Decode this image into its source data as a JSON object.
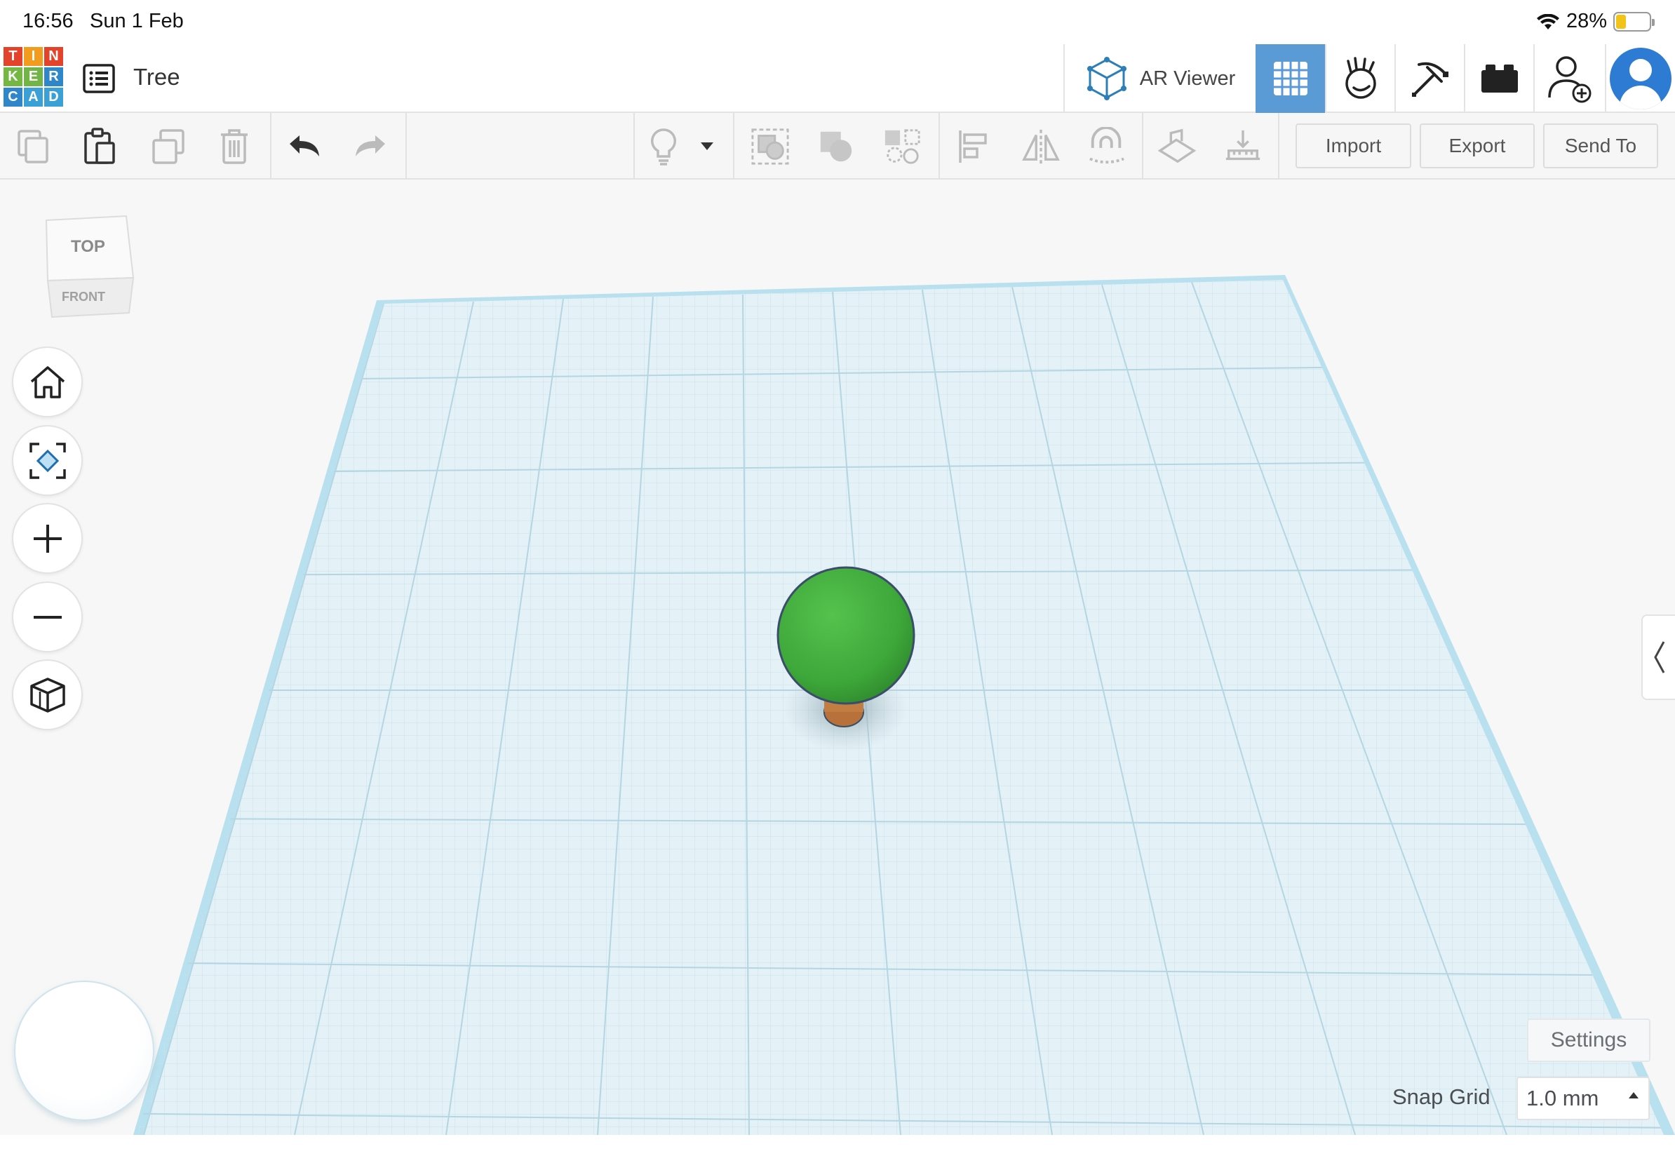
{
  "status_bar": {
    "time": "16:56",
    "date": "Sun 1 Feb",
    "battery": "28%"
  },
  "header": {
    "logo_letters": [
      "T",
      "I",
      "N",
      "K",
      "E",
      "R",
      "C",
      "A",
      "D"
    ],
    "logo_colors": [
      "#e2432a",
      "#f29c1f",
      "#72b546",
      "#74b843",
      "#e2432a",
      "#2f86c9",
      "#2f86c9",
      "#f29c1f",
      "#3aa0d6"
    ],
    "design_title": "Tree",
    "ar_viewer_label": "AR Viewer",
    "active_view": "3d-design-view",
    "accent_color": "#5b9bd5"
  },
  "toolbar": {
    "import_label": "Import",
    "export_label": "Export",
    "send_to_label": "Send To"
  },
  "view_cube": {
    "top_label": "TOP",
    "front_label": "FRONT"
  },
  "workplane": {
    "settings_label": "Settings",
    "snap_grid_label": "Snap Grid",
    "snap_grid_value": "1.0 mm",
    "plane_color": "#d9eef5",
    "border_color": "#a9d9ea"
  },
  "scene": {
    "shapes": [
      {
        "name": "sphere",
        "color": "#43a63e"
      },
      {
        "name": "trunk-cylinder",
        "color": "#c07a3a"
      }
    ]
  }
}
